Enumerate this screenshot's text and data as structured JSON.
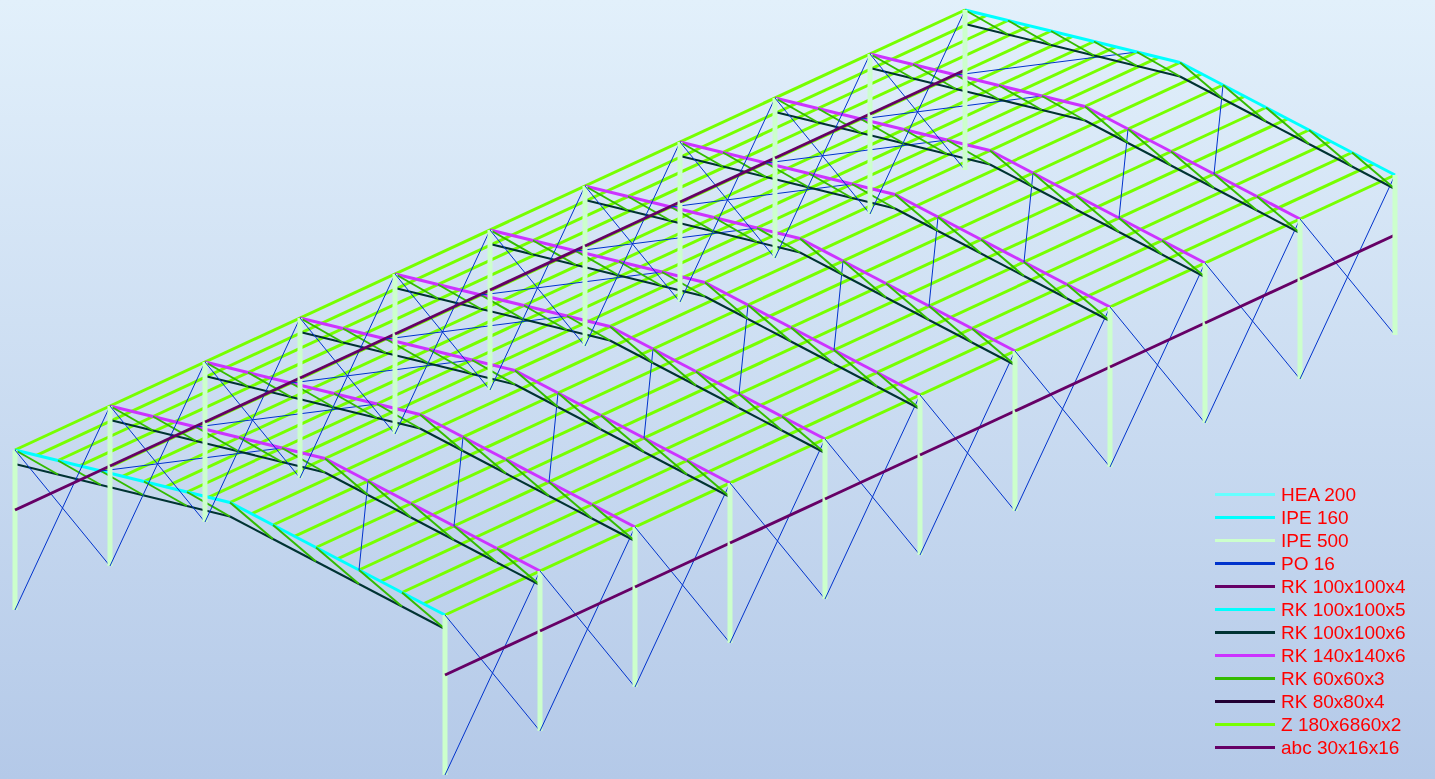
{
  "legend": [
    {
      "label": "HEA 200",
      "color": "#66ffff"
    },
    {
      "label": "IPE 160",
      "color": "#00ffff"
    },
    {
      "label": "IPE 500",
      "color": "#ccffcc"
    },
    {
      "label": "PO 16",
      "color": "#0033cc"
    },
    {
      "label": "RK 100x100x4",
      "color": "#660066"
    },
    {
      "label": "RK 100x100x5",
      "color": "#00ffff"
    },
    {
      "label": "RK 100x100x6",
      "color": "#003333"
    },
    {
      "label": "RK 140x140x6",
      "color": "#cc33ff"
    },
    {
      "label": "RK 60x60x3",
      "color": "#33bb00"
    },
    {
      "label": "RK 80x80x4",
      "color": "#220033"
    },
    {
      "label": "Z 180x6860x2",
      "color": "#77ff00"
    },
    {
      "label": "abc 30x16x16",
      "color": "#660066"
    }
  ]
}
